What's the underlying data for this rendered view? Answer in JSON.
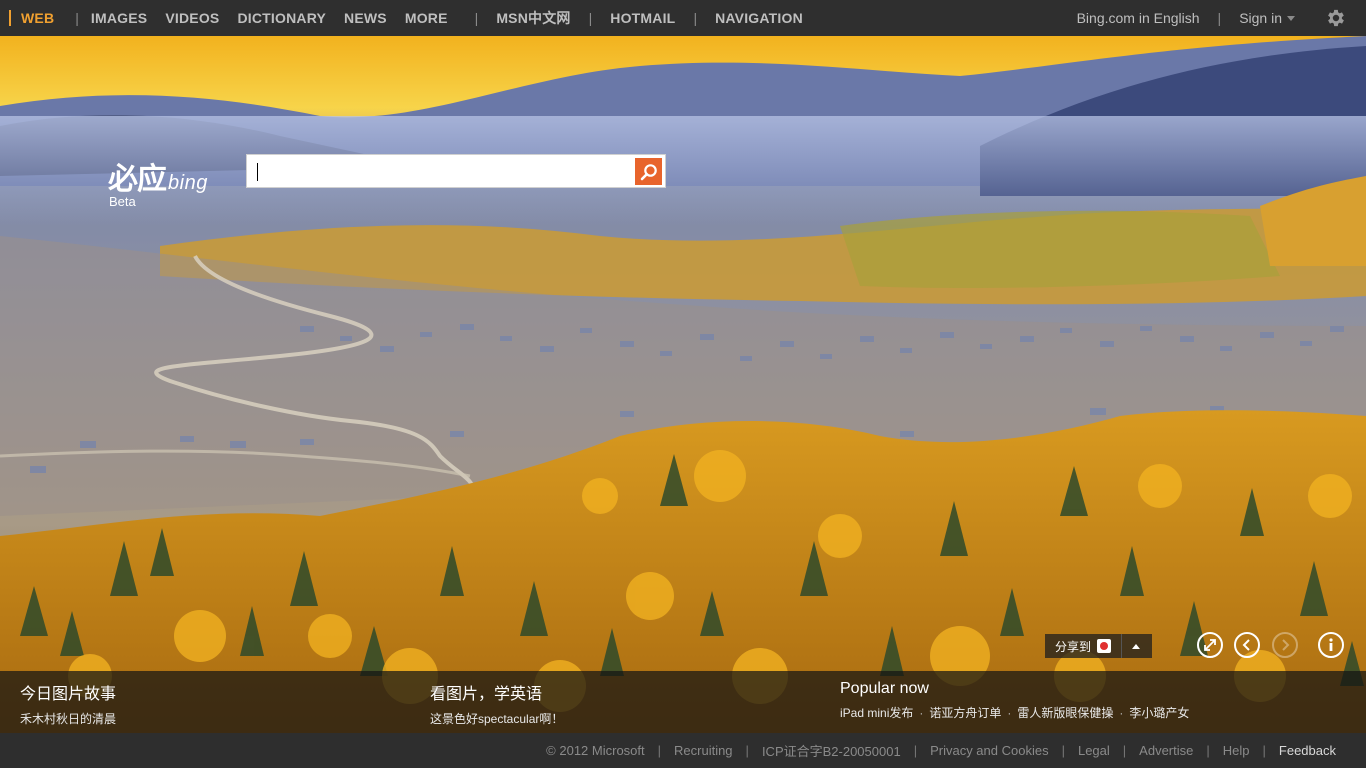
{
  "nav": {
    "web": "WEB",
    "items": [
      "IMAGES",
      "VIDEOS",
      "DICTIONARY",
      "NEWS",
      "MORE"
    ],
    "msn": "MSN中文网",
    "hotmail": "HOTMAIL",
    "navigation": "NAVIGATION"
  },
  "account": {
    "english": "Bing.com in English",
    "signin": "Sign in"
  },
  "logo": {
    "zh": "必应",
    "bing": "bing",
    "beta": "Beta"
  },
  "search": {
    "value": "",
    "placeholder": ""
  },
  "share": {
    "label": "分享到"
  },
  "captions": [
    {
      "title": "今日图片故事",
      "sub": "禾木村秋日的清晨"
    },
    {
      "title": "看图片，学英语",
      "sub": "这景色好spectacular啊！"
    },
    {
      "title": "Popular now",
      "items": [
        "iPad mini发布",
        "诺亚方舟订单",
        "雷人新版眼保健操",
        "李小璐产女"
      ]
    }
  ],
  "footer": {
    "copyright": "© 2012 Microsoft",
    "recruiting": "Recruiting",
    "icp": "ICP证合字B2-20050001",
    "privacy": "Privacy and Cookies",
    "legal": "Legal",
    "advertise": "Advertise",
    "help": "Help",
    "feedback": "Feedback"
  },
  "colors": {
    "accent": "#f0a030",
    "search_button": "#e8642c",
    "topbar": "#2f2f2f"
  },
  "icons": [
    "gear-icon",
    "search-icon",
    "weibo-icon",
    "expand-icon",
    "prev-arrow-icon",
    "next-arrow-icon",
    "info-icon"
  ]
}
